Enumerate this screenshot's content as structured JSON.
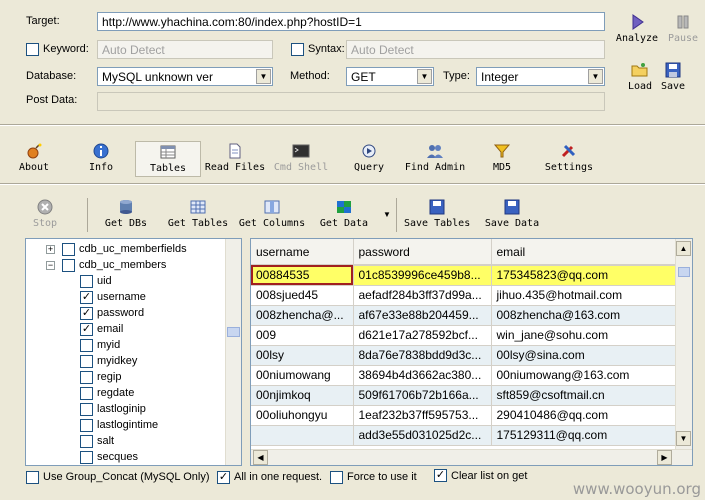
{
  "form": {
    "target_label": "Target:",
    "target_value": "http://www.yhachina.com:80/index.php?hostID=1",
    "keyword_label": "Keyword:",
    "keyword_placeholder": "Auto Detect",
    "syntax_label": "Syntax:",
    "syntax_placeholder": "Auto Detect",
    "database_label": "Database:",
    "database_value": "MySQL unknown ver",
    "method_label": "Method:",
    "method_value": "GET",
    "type_label": "Type:",
    "type_value": "Integer",
    "postdata_label": "Post Data:"
  },
  "side_buttons": {
    "analyze": "Analyze",
    "pause": "Pause",
    "load": "Load",
    "save": "Save"
  },
  "main_toolbar": [
    {
      "label": "About",
      "icon": "bomb-icon"
    },
    {
      "label": "Info",
      "icon": "info-icon"
    },
    {
      "label": "Tables",
      "icon": "table-icon"
    },
    {
      "label": "Read Files",
      "icon": "file-icon"
    },
    {
      "label": "Cmd Shell",
      "icon": "terminal-icon"
    },
    {
      "label": "Query",
      "icon": "query-icon"
    },
    {
      "label": "Find Admin",
      "icon": "users-icon"
    },
    {
      "label": "MD5",
      "icon": "funnel-icon"
    },
    {
      "label": "Settings",
      "icon": "tools-icon"
    }
  ],
  "sub_toolbar": {
    "stop": "Stop",
    "get_dbs": "Get DBs",
    "get_tables": "Get Tables",
    "get_columns": "Get Columns",
    "get_data": "Get Data",
    "save_tables": "Save Tables",
    "save_data": "Save Data"
  },
  "tree": [
    {
      "label": "cdb_uc_memberfields",
      "level": 0,
      "expander": "+",
      "checked": false
    },
    {
      "label": "cdb_uc_members",
      "level": 0,
      "expander": "−",
      "checked": false
    },
    {
      "label": "uid",
      "level": 1,
      "checked": false
    },
    {
      "label": "username",
      "level": 1,
      "checked": true
    },
    {
      "label": "password",
      "level": 1,
      "checked": true
    },
    {
      "label": "email",
      "level": 1,
      "checked": true
    },
    {
      "label": "myid",
      "level": 1,
      "checked": false
    },
    {
      "label": "myidkey",
      "level": 1,
      "checked": false
    },
    {
      "label": "regip",
      "level": 1,
      "checked": false
    },
    {
      "label": "regdate",
      "level": 1,
      "checked": false
    },
    {
      "label": "lastloginip",
      "level": 1,
      "checked": false
    },
    {
      "label": "lastlogintime",
      "level": 1,
      "checked": false
    },
    {
      "label": "salt",
      "level": 1,
      "checked": false
    },
    {
      "label": "secques",
      "level": 1,
      "checked": false
    }
  ],
  "grid": {
    "columns": [
      "username",
      "password",
      "email"
    ],
    "rows": [
      [
        "00884535",
        "01c8539996ce459b8...",
        "175345823@qq.com"
      ],
      [
        "008sjued45",
        "aefadf284b3ff37d99a...",
        "jihuo.435@hotmail.com"
      ],
      [
        "008zhencha@...",
        "af67e33e88b204459...",
        "008zhencha@163.com"
      ],
      [
        "009",
        "d621e17a278592bcf...",
        "win_jane@sohu.com"
      ],
      [
        "00lsy",
        "8da76e7838bdd9d3c...",
        "00lsy@sina.com"
      ],
      [
        "00niumowang",
        "38694b4d3662ac380...",
        "00niumowang@163.com"
      ],
      [
        "00njimkoq",
        "509f61706b72b166a...",
        "sft859@csoftmail.cn"
      ],
      [
        "00oliuhongyu",
        "1eaf232b37ff595753...",
        "290410486@qq.com"
      ],
      [
        "",
        "add3e55d031025d2c...",
        "175129311@qq.com"
      ]
    ]
  },
  "footer": {
    "group_concat": "Use Group_Concat (MySQL Only)",
    "all_in_one": "All in one request.",
    "force": "Force to use it",
    "clear_list": "Clear list on get"
  },
  "watermark": "www.wooyun.org"
}
